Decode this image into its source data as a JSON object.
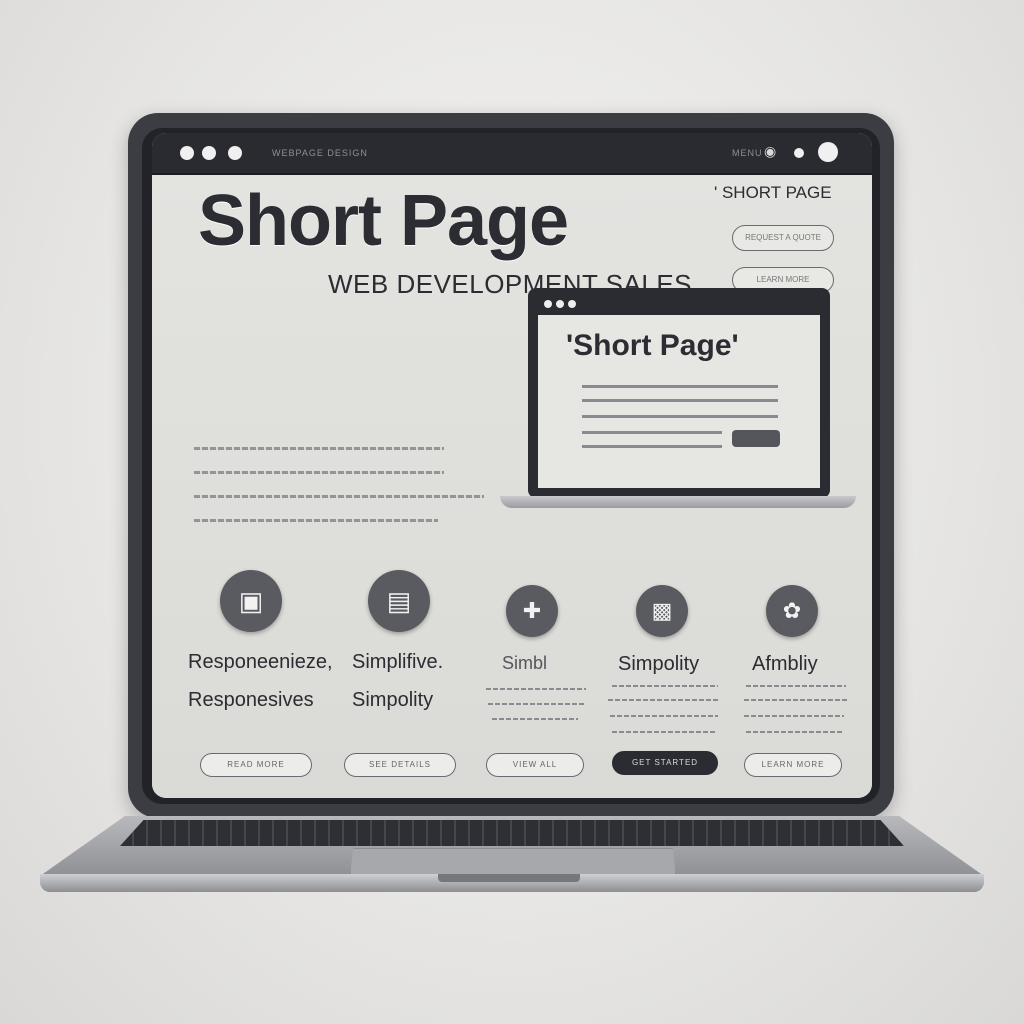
{
  "browser": {
    "address_text": "WEBPAGE DESIGN",
    "right_text": "MENU"
  },
  "hero": {
    "title": "Short Page",
    "subtitle": "WEB DEVELOPMENT SALES",
    "top_label": "' SHORT PAGE",
    "button1": "REQUEST A QUOTE",
    "button2": "LEARN MORE"
  },
  "preview": {
    "title": "'Short Page'"
  },
  "features": [
    {
      "icon": "monitor-icon",
      "title": "Responeenieze,",
      "subtitle": "Responesives"
    },
    {
      "icon": "layout-icon",
      "title": "Simplifive.",
      "subtitle": "Simpolity"
    },
    {
      "icon": "puzzle-icon",
      "title": "Simbl",
      "subtitle": ""
    },
    {
      "icon": "box-icon",
      "title": "Simpolity",
      "subtitle": ""
    },
    {
      "icon": "badge-icon",
      "title": "Afmbliy",
      "subtitle": ""
    }
  ],
  "buttons": [
    {
      "label": "READ MORE",
      "style": "outline"
    },
    {
      "label": "SEE DETAILS",
      "style": "outline"
    },
    {
      "label": "VIEW ALL",
      "style": "outline"
    },
    {
      "label": "GET STARTED",
      "style": "dark"
    },
    {
      "label": "LEARN MORE",
      "style": "outline"
    }
  ]
}
